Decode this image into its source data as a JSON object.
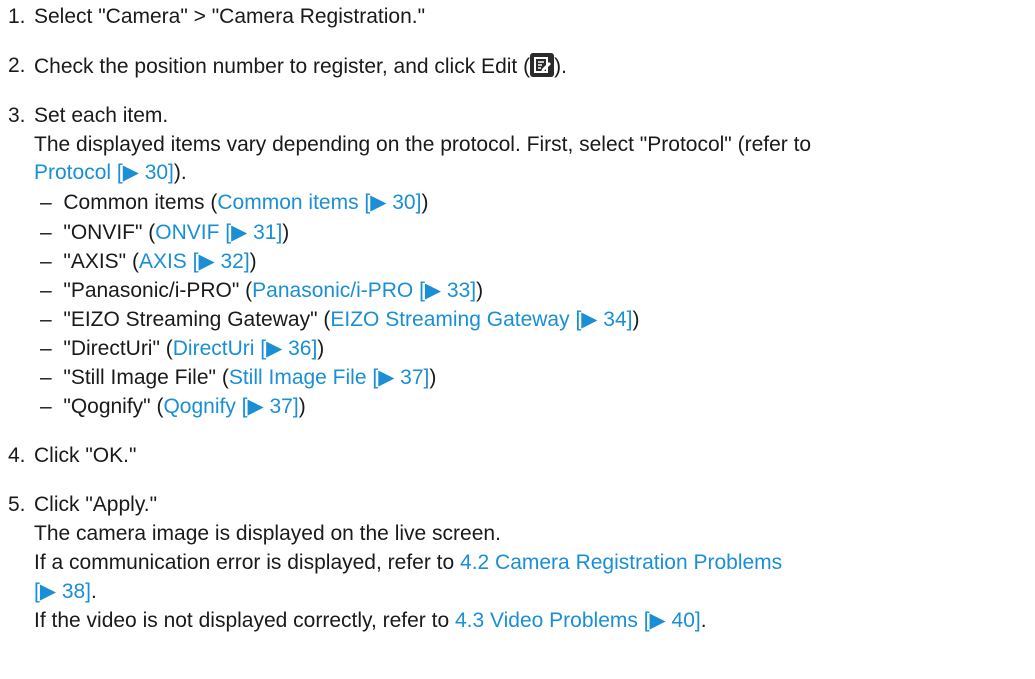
{
  "steps": [
    {
      "num": "1.",
      "text": "Select \"Camera\" > \"Camera Registration.\""
    },
    {
      "num": "2.",
      "text_before": "Check the position number to register, and click Edit (",
      "text_after": ").",
      "icon": "edit-icon"
    },
    {
      "num": "3.",
      "text": "Set each item.",
      "note_line1": "The displayed items vary depending on the protocol. First, select \"Protocol\" (refer to",
      "note_link": "Protocol [▶ 30]",
      "note_tail": ").",
      "items": [
        {
          "dash": "–",
          "label": "Common items (",
          "link": "Common items [▶ 30]",
          "tail": ")"
        },
        {
          "dash": "–",
          "label": "\"ONVIF\" (",
          "link": "ONVIF [▶ 31]",
          "tail": ")"
        },
        {
          "dash": "–",
          "label": "\"AXIS\" (",
          "link": "AXIS [▶ 32]",
          "tail": ")"
        },
        {
          "dash": "–",
          "label": "\"Panasonic/i-PRO\" (",
          "link": "Panasonic/i-PRO [▶ 33]",
          "tail": ")"
        },
        {
          "dash": "–",
          "label": "\"EIZO Streaming Gateway\" (",
          "link": "EIZO Streaming Gateway [▶ 34]",
          "tail": ")"
        },
        {
          "dash": "–",
          "label": "\"DirectUri\" (",
          "link": "DirectUri [▶ 36]",
          "tail": ")"
        },
        {
          "dash": "–",
          "label": "\"Still Image File\" (",
          "link": "Still Image File [▶ 37]",
          "tail": ")"
        },
        {
          "dash": "–",
          "label": "\"Qognify\" (",
          "link": "Qognify [▶ 37]",
          "tail": ")"
        }
      ]
    },
    {
      "num": "4.",
      "text": "Click \"OK.\""
    },
    {
      "num": "5.",
      "text": "Click \"Apply.\"",
      "line2": "The camera image is displayed on the live screen.",
      "line3_before": "If a communication error is displayed, refer to ",
      "line3_link": "4.2 Camera Registration Problems",
      "line3_link2": "[▶ 38]",
      "line3_after": ".",
      "line4_before": "If the video is not displayed correctly, refer to ",
      "line4_link": "4.3 Video Problems [▶ 40]",
      "line4_after": "."
    }
  ],
  "colors": {
    "text": "#1a1a1a",
    "link": "#1a8fd6",
    "icon_bg": "#2b2b2b"
  }
}
